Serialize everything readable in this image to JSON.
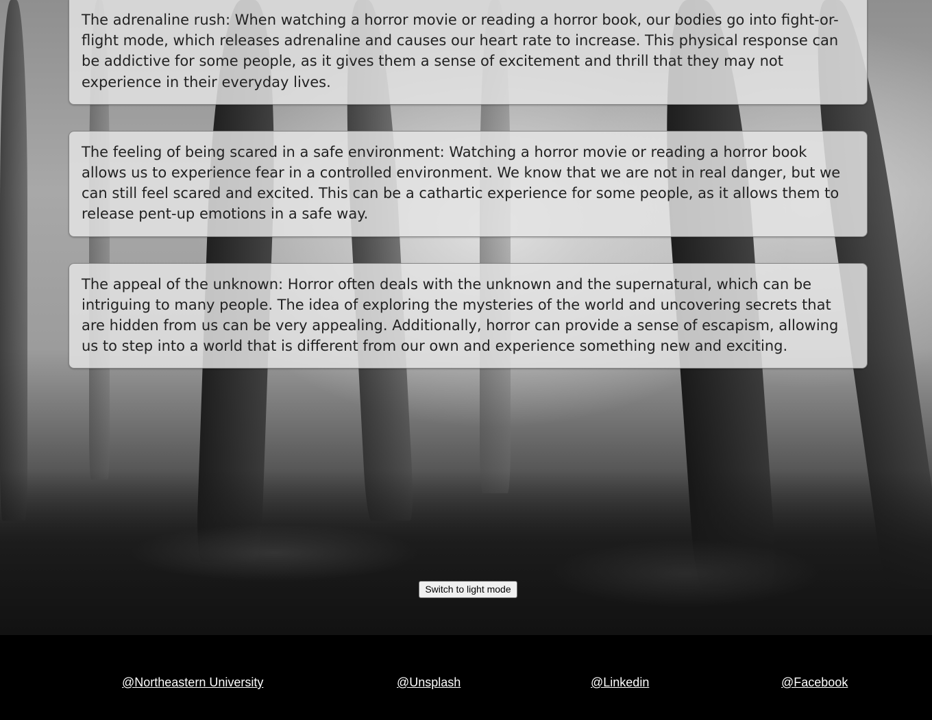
{
  "cards": [
    {
      "text": "The adrenaline rush: When watching a horror movie or reading a horror book, our bodies go into fight-or-flight mode, which releases adrenaline and causes our heart rate to increase. This physical response can be addictive for some people, as it gives them a sense of excitement and thrill that they may not experience in their everyday lives."
    },
    {
      "text": "The feeling of being scared in a safe environment: Watching a horror movie or reading a horror book allows us to experience fear in a controlled environment. We know that we are not in real danger, but we can still feel scared and excited. This can be a cathartic experience for some people, as it allows them to release pent-up emotions in a safe way."
    },
    {
      "text": "The appeal of the unknown: Horror often deals with the unknown and the supernatural, which can be intriguing to many people. The idea of exploring the mysteries of the world and uncovering secrets that are hidden from us can be very appealing. Additionally, horror can provide a sense of escapism, allowing us to step into a world that is different from our own and experience something new and exciting."
    }
  ],
  "theme_toggle": {
    "label": "Switch to light mode"
  },
  "footer": {
    "links": [
      {
        "label": "@Northeastern University"
      },
      {
        "label": "@Unsplash"
      },
      {
        "label": "@Linkedin"
      },
      {
        "label": "@Facebook"
      }
    ]
  },
  "colors": {
    "card_background": "#e4e4e4",
    "text": "#222222",
    "footer_background": "#000000",
    "footer_link": "#ffffff"
  }
}
